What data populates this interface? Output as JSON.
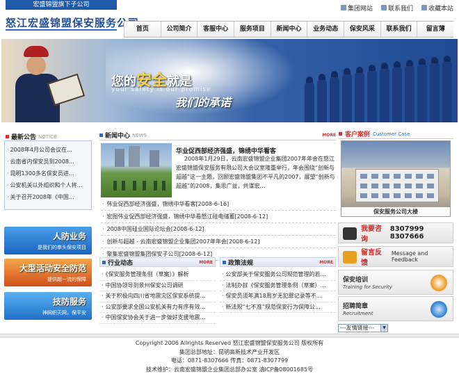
{
  "header": {
    "subtag": "宏盛锦盟旗下子公司",
    "logo": "怒江宏盛锦盟保安服务公司",
    "top_links": [
      "集团网站",
      "联系我们",
      "收藏本站"
    ]
  },
  "nav": [
    "首页",
    "公司简介",
    "客服中心",
    "服务项目",
    "新闻中心",
    "业务动态",
    "保安风采",
    "联系我们",
    "留言薄"
  ],
  "banner": {
    "slogan_pre": "您的",
    "slogan_em": "安全",
    "slogan_post": "就是",
    "slogan_en": "your safety is our promise",
    "slogan2": "我们的承诺"
  },
  "latest": {
    "title": "最新公告",
    "subtitle": "NOTICE",
    "items": [
      "2008年4月公司会议在…",
      "云南省内保安员到2008…",
      "昆明1300多名保安员进…",
      "公安机关以外组织和个人将…",
      "关于召开2008年《中国…"
    ]
  },
  "services": [
    {
      "title": "人防业务",
      "sub": "是我们的拳头保安项目"
    },
    {
      "title": "大型活动安全防范",
      "sub": "提供超一流的保障"
    },
    {
      "title": "技防服务",
      "sub": "神网织天网，保平安"
    }
  ],
  "news": {
    "title": "新闻中心",
    "subtitle": "NEWS",
    "more": "MORE",
    "feature_title": "华业促西部经济强盛，锦绣中华看客",
    "feature_body": "2008年1月29日，云南宏盛锦盟企业集团2007年年会在怒江宏盛锦盟保安服务有限公司大会议室隆重举行，年会围绕“创新与超越”这一主题，回顾宏盛锦盟集团不平凡的2007，展望“创新与超越”的2008，集思广益，共谋宏…",
    "items": [
      "伟业促西部经济强盛，锦绣中华看客[2008-6-16]",
      "宏图伟业促西部经济强盛，锦绣中华看怒江硅电储蓄[2008-6-12]",
      "2008中国硅业国际论坛会[2008-6-12]",
      "创新与超越 - 云南宏盛锦盟企业集团2007年年会[2008-6-12]",
      "聚集宏盛锦盟集团保安子公司[2008-6-12]"
    ]
  },
  "industry": {
    "title": "行业动态",
    "more": "MORE",
    "items": [
      "《保安服务管理条例（草案）》解析",
      "中国协领导到景州保安公司调研",
      "关于积极向四川省地震灾区保安系统提…",
      "公安部要求全国公安机关有力有序有效…",
      "中国保安协会关于进一步做好支援地震…"
    ]
  },
  "policy": {
    "title": "政策法规",
    "more": "MORE",
    "items": [
      "公安部关于保安服务公司规范管理的若…",
      "法制办就《保安服务管理条例（草案）…",
      "保安员须年满18周岁无犯罪记录等不…",
      "新法规“七不准”规范保安行为保障公…"
    ]
  },
  "right": {
    "case_title": "客户案例",
    "case_en": "Customer Case",
    "case_caption": "保安服务公司大楼",
    "hotline_label": "我要咨询",
    "hotline_num": "8307999  8307666",
    "msg_label": "留言反馈",
    "msg_en": "Message and Feedback",
    "train_cn": "保安培训",
    "train_en": "Training for Security",
    "recruit_cn": "招聘简章",
    "recruit_en": "Recruitment",
    "links_label": "---友情链接---"
  },
  "footer": {
    "line1": "Copyright 2006 Allrights Reserved 怒江宏盛锦盟保安服务公司 版权所有",
    "line2": "集团总部地址：昆明高新技术产业开发区",
    "line3": "电话：0871-8307666 传真：0871-8307799",
    "line4": "技术维护：云南宏盛锦盟企业集团总部办公室 滇ICP备08001685号"
  },
  "colors": {
    "nav_blue": "#1e4f9c",
    "accent_red": "#d33"
  }
}
